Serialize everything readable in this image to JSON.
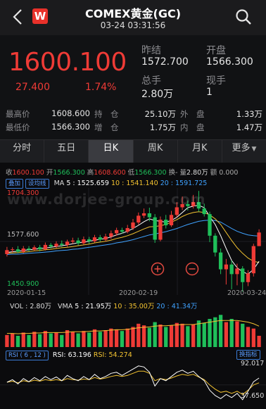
{
  "header": {
    "title": "COMEX黄金(GC)",
    "subtitle": "03-24 03:31:56",
    "logo_text": "W"
  },
  "quote": {
    "price": "1600.100",
    "change": "27.400",
    "change_pct": "1.74%",
    "prev_close_label": "昨结",
    "prev_close": "1572.700",
    "open_label": "开盘",
    "open": "1566.300",
    "volume_label": "总手",
    "volume": "2.80万",
    "current_label": "现手",
    "current": "1"
  },
  "stats": {
    "high_label": "最高价",
    "high": "1608.600",
    "hold_label": "持　仓",
    "hold": "25.10万",
    "outer_label": "外　盘",
    "outer": "1.33万",
    "low_label": "最低价",
    "low": "1566.300",
    "add_label": "增　仓",
    "add": "1.75万",
    "inner_label": "内　盘",
    "inner": "1.47万"
  },
  "tabs": [
    "分时",
    "五日",
    "日K",
    "周K",
    "月K",
    "更多"
  ],
  "info_line": {
    "receive_label": "收",
    "receive": "1600.100",
    "open_label": "开",
    "open": "1566.300",
    "high_label": "高",
    "high": "1608.600",
    "low_label": "低",
    "low": "1566.300",
    "change_label": "换-",
    "volume_label": "量",
    "volume": "2.80万",
    "amount": "额 0.000"
  },
  "ma_line": {
    "chip1": "叠加",
    "chip2": "设均线",
    "ma_label": "MA",
    "ma5": "5 : 1525.659",
    "ma10": "10 : 1541.140",
    "ma20": "20 : 1591.725"
  },
  "price_axis": {
    "top": "1704.300",
    "mid": "1577.600",
    "bottom": "1450.900"
  },
  "date_axis": [
    "2020-01-15",
    "2020-02-19",
    "2020-03-24"
  ],
  "watermark": "www.dorjee-group.com",
  "vol_line": {
    "vol_label": "VOL :",
    "vol": "2.80万",
    "vma_label": "VMA",
    "v5": "5 : 21.95万",
    "v10": "10 : 35.00万",
    "v20": "20 : 41.34万"
  },
  "rsi_line": {
    "chip": "RSI ( 6 , 12 )",
    "rsi1": "RSI: 63.196",
    "rsi2": "RSI: 54.274",
    "switch": "换指标",
    "top": "92.017",
    "bottom": "37.650"
  },
  "colors": {
    "up": "#ef3b36",
    "down": "#1fbf5a",
    "ma5": "#ffffff",
    "ma10": "#f2c230",
    "ma20": "#3fa2ff"
  },
  "chart_data": {
    "type": "candlestick",
    "x": [
      "2020-01-15",
      "2020-02-19",
      "2020-03-24"
    ],
    "close_last": 1600.1,
    "ylim": [
      1450.9,
      1704.3
    ],
    "candles": [
      {
        "o": 1546,
        "c": 1556,
        "h": 1564,
        "l": 1540
      },
      {
        "o": 1556,
        "c": 1558,
        "h": 1563,
        "l": 1550
      },
      {
        "o": 1558,
        "c": 1552,
        "h": 1566,
        "l": 1548
      },
      {
        "o": 1552,
        "c": 1560,
        "h": 1566,
        "l": 1548
      },
      {
        "o": 1560,
        "c": 1557,
        "h": 1566,
        "l": 1552
      },
      {
        "o": 1557,
        "c": 1563,
        "h": 1568,
        "l": 1554
      },
      {
        "o": 1563,
        "c": 1558,
        "h": 1569,
        "l": 1553
      },
      {
        "o": 1558,
        "c": 1569,
        "h": 1575,
        "l": 1555
      },
      {
        "o": 1569,
        "c": 1565,
        "h": 1574,
        "l": 1560
      },
      {
        "o": 1565,
        "c": 1572,
        "h": 1578,
        "l": 1561
      },
      {
        "o": 1572,
        "c": 1569,
        "h": 1580,
        "l": 1564
      },
      {
        "o": 1569,
        "c": 1577,
        "h": 1582,
        "l": 1564
      },
      {
        "o": 1577,
        "c": 1580,
        "h": 1587,
        "l": 1572
      },
      {
        "o": 1580,
        "c": 1573,
        "h": 1587,
        "l": 1568
      },
      {
        "o": 1573,
        "c": 1583,
        "h": 1590,
        "l": 1570
      },
      {
        "o": 1583,
        "c": 1578,
        "h": 1589,
        "l": 1572
      },
      {
        "o": 1578,
        "c": 1588,
        "h": 1594,
        "l": 1575
      },
      {
        "o": 1588,
        "c": 1582,
        "h": 1594,
        "l": 1577
      },
      {
        "o": 1582,
        "c": 1590,
        "h": 1597,
        "l": 1578
      },
      {
        "o": 1590,
        "c": 1598,
        "h": 1605,
        "l": 1584
      },
      {
        "o": 1598,
        "c": 1606,
        "h": 1612,
        "l": 1592
      },
      {
        "o": 1606,
        "c": 1602,
        "h": 1612,
        "l": 1597
      },
      {
        "o": 1602,
        "c": 1611,
        "h": 1619,
        "l": 1598
      },
      {
        "o": 1611,
        "c": 1625,
        "h": 1634,
        "l": 1606
      },
      {
        "o": 1625,
        "c": 1642,
        "h": 1650,
        "l": 1620
      },
      {
        "o": 1642,
        "c": 1648,
        "h": 1660,
        "l": 1636
      },
      {
        "o": 1648,
        "c": 1638,
        "h": 1662,
        "l": 1628
      },
      {
        "o": 1638,
        "c": 1582,
        "h": 1646,
        "l": 1574
      },
      {
        "o": 1582,
        "c": 1632,
        "h": 1640,
        "l": 1578
      },
      {
        "o": 1632,
        "c": 1618,
        "h": 1644,
        "l": 1610
      },
      {
        "o": 1618,
        "c": 1644,
        "h": 1654,
        "l": 1614
      },
      {
        "o": 1644,
        "c": 1663,
        "h": 1676,
        "l": 1638
      },
      {
        "o": 1663,
        "c": 1671,
        "h": 1690,
        "l": 1656
      },
      {
        "o": 1671,
        "c": 1666,
        "h": 1680,
        "l": 1655
      },
      {
        "o": 1666,
        "c": 1676,
        "h": 1694,
        "l": 1660
      },
      {
        "o": 1676,
        "c": 1660,
        "h": 1704,
        "l": 1652
      },
      {
        "o": 1660,
        "c": 1646,
        "h": 1672,
        "l": 1640
      },
      {
        "o": 1646,
        "c": 1592,
        "h": 1652,
        "l": 1576
      },
      {
        "o": 1592,
        "c": 1550,
        "h": 1598,
        "l": 1540
      },
      {
        "o": 1550,
        "c": 1508,
        "h": 1560,
        "l": 1496
      },
      {
        "o": 1508,
        "c": 1520,
        "h": 1534,
        "l": 1470
      },
      {
        "o": 1520,
        "c": 1496,
        "h": 1530,
        "l": 1458
      },
      {
        "o": 1496,
        "c": 1510,
        "h": 1522,
        "l": 1468
      },
      {
        "o": 1510,
        "c": 1476,
        "h": 1516,
        "l": 1452
      },
      {
        "o": 1476,
        "c": 1498,
        "h": 1506,
        "l": 1466
      },
      {
        "o": 1498,
        "c": 1566,
        "h": 1572,
        "l": 1490
      },
      {
        "o": 1566,
        "c": 1600,
        "h": 1608,
        "l": 1566
      }
    ],
    "ma5": [
      1550,
      1552,
      1553,
      1555,
      1557,
      1558,
      1560,
      1561,
      1563,
      1565,
      1567,
      1569,
      1572,
      1574,
      1576,
      1578,
      1581,
      1583,
      1585,
      1589,
      1594,
      1598,
      1603,
      1610,
      1618,
      1627,
      1634,
      1630,
      1628,
      1626,
      1630,
      1638,
      1650,
      1662,
      1666,
      1668,
      1662,
      1640,
      1620,
      1592,
      1560,
      1530,
      1512,
      1502,
      1496,
      1508,
      1528
    ],
    "ma10": [
      1548,
      1549,
      1550,
      1551,
      1552,
      1554,
      1555,
      1557,
      1558,
      1560,
      1562,
      1563,
      1565,
      1567,
      1569,
      1571,
      1574,
      1576,
      1578,
      1581,
      1585,
      1588,
      1592,
      1597,
      1603,
      1609,
      1614,
      1615,
      1617,
      1620,
      1626,
      1632,
      1640,
      1646,
      1650,
      1652,
      1650,
      1644,
      1634,
      1620,
      1600,
      1580,
      1562,
      1548,
      1536,
      1528,
      1525
    ],
    "ma20": [
      1545,
      1546,
      1546,
      1547,
      1548,
      1549,
      1550,
      1551,
      1552,
      1554,
      1555,
      1556,
      1558,
      1559,
      1561,
      1563,
      1565,
      1567,
      1569,
      1571,
      1574,
      1576,
      1579,
      1582,
      1586,
      1590,
      1594,
      1596,
      1599,
      1602,
      1606,
      1610,
      1615,
      1620,
      1624,
      1628,
      1630,
      1631,
      1630,
      1626,
      1618,
      1610,
      1603,
      1598,
      1594,
      1592,
      1591
    ],
    "volumes": [
      30,
      34,
      28,
      36,
      30,
      38,
      32,
      40,
      34,
      36,
      30,
      42,
      38,
      34,
      40,
      36,
      44,
      38,
      42,
      46,
      44,
      40,
      46,
      50,
      58,
      54,
      48,
      62,
      56,
      50,
      54,
      60,
      58,
      52,
      56,
      66,
      60,
      70,
      74,
      80,
      62,
      70,
      64,
      58,
      50,
      46,
      28
    ],
    "vma": [
      34,
      34,
      33,
      34,
      34,
      35,
      35,
      36,
      36,
      36,
      36,
      37,
      38,
      38,
      38,
      39,
      40,
      40,
      41,
      42,
      43,
      43,
      44,
      46,
      48,
      49,
      50,
      52,
      53,
      53,
      54,
      55,
      56,
      56,
      56,
      58,
      60,
      62,
      64,
      66,
      66,
      66,
      66,
      64,
      62,
      58,
      52
    ],
    "rsi6": [
      55,
      60,
      52,
      62,
      56,
      64,
      58,
      66,
      60,
      65,
      58,
      68,
      62,
      58,
      66,
      60,
      70,
      62,
      66,
      72,
      74,
      68,
      74,
      80,
      86,
      84,
      74,
      48,
      62,
      58,
      66,
      74,
      78,
      72,
      76,
      66,
      58,
      40,
      30,
      24,
      32,
      26,
      34,
      22,
      38,
      56,
      63
    ],
    "rsi12": [
      55,
      57,
      54,
      58,
      56,
      59,
      57,
      60,
      58,
      60,
      58,
      62,
      60,
      59,
      61,
      60,
      64,
      61,
      63,
      66,
      68,
      66,
      68,
      72,
      76,
      76,
      72,
      58,
      62,
      60,
      63,
      67,
      70,
      68,
      70,
      65,
      60,
      50,
      42,
      36,
      38,
      34,
      38,
      32,
      40,
      50,
      54
    ]
  }
}
